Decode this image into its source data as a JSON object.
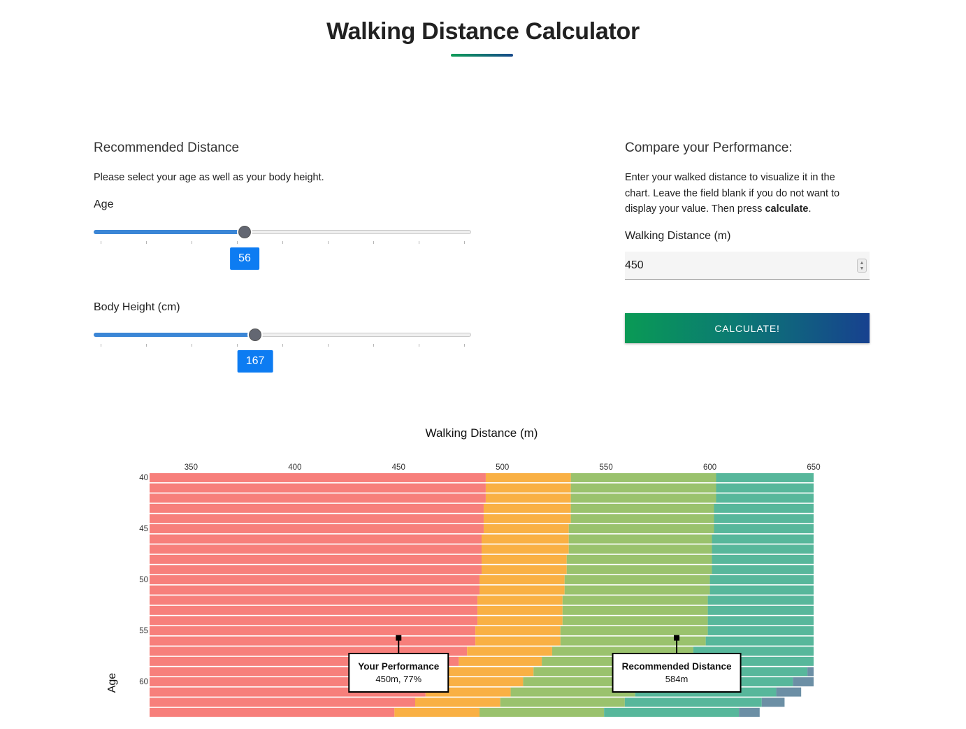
{
  "header": {
    "title": "Walking Distance Calculator"
  },
  "recommended": {
    "heading": "Recommended Distance",
    "description": "Please select your age as well as your body height.",
    "age": {
      "label": "Age",
      "value": 56,
      "fraction": 0.4
    },
    "height": {
      "label": "Body Height (cm)",
      "value": 167,
      "fraction": 0.428
    }
  },
  "compare": {
    "heading": "Compare your Performance:",
    "description_line1": "Enter your walked distance to visualize it in the",
    "description_line2": "chart. Leave the field blank if you do not want to",
    "description_line3_prefix": "display your value. Then press ",
    "description_line3_bold": "calculate",
    "description_line3_suffix": ".",
    "distance_label": "Walking Distance (m)",
    "distance_value": "450",
    "button_label": "Calculate!"
  },
  "chart_data": {
    "type": "bar",
    "orientation": "horizontal-stacked",
    "title": "Walking Distance (m)",
    "ylabel": "Age",
    "xlim": [
      330,
      650
    ],
    "x_ticks": [
      350,
      400,
      450,
      500,
      550,
      600,
      650
    ],
    "y_ticks": [
      40,
      45,
      50,
      55,
      60
    ],
    "ages": [
      40,
      41,
      42,
      43,
      44,
      45,
      46,
      47,
      48,
      49,
      50,
      51,
      52,
      53,
      54,
      55,
      56,
      57,
      58,
      59,
      60,
      61,
      62,
      63
    ],
    "band_colors": [
      "#f77f7b",
      "#f9b044",
      "#9ac26d",
      "#57b79b",
      "#6c8fa5"
    ],
    "boundaries": [
      [
        492,
        533,
        603,
        650,
        650
      ],
      [
        492,
        533,
        603,
        650,
        650
      ],
      [
        492,
        533,
        603,
        650,
        650
      ],
      [
        491,
        533,
        602,
        650,
        650
      ],
      [
        491,
        533,
        602,
        650,
        650
      ],
      [
        491,
        532,
        602,
        650,
        650
      ],
      [
        490,
        532,
        601,
        650,
        650
      ],
      [
        490,
        532,
        601,
        650,
        650
      ],
      [
        490,
        531,
        601,
        650,
        650
      ],
      [
        490,
        531,
        601,
        650,
        650
      ],
      [
        489,
        530,
        600,
        650,
        650
      ],
      [
        489,
        530,
        600,
        650,
        650
      ],
      [
        488,
        529,
        599,
        650,
        650
      ],
      [
        488,
        529,
        599,
        650,
        650
      ],
      [
        488,
        529,
        599,
        650,
        650
      ],
      [
        487,
        528,
        599,
        650,
        650
      ],
      [
        487,
        528,
        598,
        650,
        650
      ],
      [
        483,
        524,
        592,
        650,
        650
      ],
      [
        479,
        519,
        585,
        650,
        650
      ],
      [
        474,
        515,
        578,
        647,
        650
      ],
      [
        469,
        510,
        570,
        640,
        650
      ],
      [
        463,
        504,
        564,
        632,
        644
      ],
      [
        458,
        499,
        559,
        625,
        636
      ],
      [
        448,
        489,
        549,
        614,
        624
      ]
    ],
    "markers": [
      {
        "label": "Your Performance",
        "value_text": "450m, 77%",
        "x": 450,
        "age": 56
      },
      {
        "label": "Recommended Distance",
        "value_text": "584m",
        "x": 584,
        "age": 56
      }
    ]
  }
}
